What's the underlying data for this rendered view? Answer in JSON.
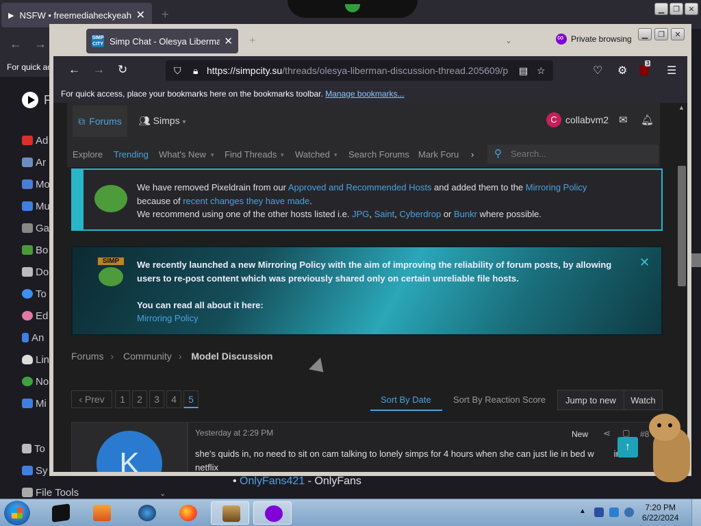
{
  "outer_browser": {
    "tab_title": "NSFW • freemediaheckyeah",
    "tab_close": "✕",
    "new_tab": "+",
    "bookmark_hint": "For quick ac",
    "sidebar_items": [
      {
        "label": "F",
        "icon": "play-logo"
      },
      {
        "label": "Ad",
        "icon": "stop-icon",
        "color": "#d9302c"
      },
      {
        "label": "Ar",
        "icon": "robot-icon",
        "color": "#6c8ebf"
      },
      {
        "label": "Mo",
        "icon": "tv-icon",
        "color": "#4a7fd0"
      },
      {
        "label": "Mu",
        "icon": "music-icon",
        "color": "#3f7fe0"
      },
      {
        "label": "Ga",
        "icon": "gamepad-icon",
        "color": "#888888"
      },
      {
        "label": "Bo",
        "icon": "book-icon",
        "color": "#4a9a3a"
      },
      {
        "label": "Do",
        "icon": "floppy-icon",
        "color": "#bbbbbb"
      },
      {
        "label": "To",
        "icon": "torrent-icon",
        "color": "#3f8ff0"
      },
      {
        "label": "Ed",
        "icon": "brain-icon",
        "color": "#e07aa0"
      },
      {
        "label": "An",
        "icon": "phone-icon",
        "color": "#3f7fe0"
      },
      {
        "label": "Lin",
        "icon": "penguin-icon",
        "color": "#dddddd"
      },
      {
        "label": "No",
        "icon": "globe-icon",
        "color": "#3fa040"
      },
      {
        "label": "Mi",
        "icon": "folder-icon",
        "color": "#3f7fe0"
      },
      {
        "label": "To",
        "icon": "wrench-icon",
        "color": "#bbbbbb"
      },
      {
        "label": "Sy",
        "icon": "computer-icon",
        "color": "#3f7fe0"
      },
      {
        "label": "File Tools",
        "icon": "file-icon",
        "color": "#aaaaaa"
      }
    ],
    "bottom_link": "OnlyFans421",
    "bottom_suffix": " - OnlyFans"
  },
  "front_browser": {
    "tab_title": "Simp Chat - Olesya Liberman - ",
    "tab_favicon": "SIMP CITY",
    "tab_close": "✕",
    "new_tab": "+",
    "private_label": "Private browsing",
    "url_host": "https://simpcity.su",
    "url_path": "/threads/olesya-liberman-discussion-thread.205609/p",
    "ublock_count": "3",
    "bookmarks_hint": "For quick access, place your bookmarks here on the bookmarks toolbar.",
    "bookmarks_link": "Manage bookmarks..."
  },
  "site": {
    "nav_forums": "Forums",
    "nav_simps": "Simps",
    "user_initial": "C",
    "username": "collabvm2",
    "subnav": [
      "Explore",
      "Trending",
      "What's New",
      "Find Threads",
      "Watched",
      "Search Forums",
      "Mark Foru"
    ],
    "search_placeholder": "Search...",
    "notice1": {
      "t1": "We have removed Pixeldrain from our ",
      "l1": "Approved and Recommended Hosts",
      "t2": " and added them to the ",
      "l2": "Mirroring Policy",
      "t3": "because of ",
      "l3": "recent changes they have made",
      "t4": ".",
      "t5": "We recommend using one of the other hosts listed i.e. ",
      "l4": "JPG",
      "c1": ", ",
      "l5": "Saint",
      "c2": ", ",
      "l6": "Cyberdrop",
      "t6": " or ",
      "l7": "Bunkr",
      "t7": " where possible."
    },
    "notice2": {
      "badge": "SIMP",
      "text": "We recently launched a new Mirroring Policy with the aim of improving the reliability of forum posts, by allowing users to re-post content which was previously shared only on certain unreliable file hosts.",
      "text2": "You can read all about it here:",
      "link": "Mirroring Policy",
      "close": "✕"
    },
    "breadcrumb": [
      "Forums",
      "Community",
      "Model Discussion"
    ],
    "pager": {
      "prev": "‹ Prev",
      "pages": [
        "1",
        "2",
        "3",
        "4",
        "5"
      ],
      "current": "5"
    },
    "sort_date": "Sort By Date",
    "sort_reaction": "Sort By Reaction Score",
    "jump_new": "Jump to new",
    "watch": "Watch",
    "post": {
      "avatar_initial": "K",
      "date": "Yesterday at 2:29 PM",
      "new_badge": "New",
      "number": "#8",
      "text": "she's quids in, no need to sit on cam talking to lonely simps for 4 hours when she can just lie in bed w",
      "text_after": "in",
      "text2": "netflix"
    }
  },
  "taskbar": {
    "time": "7:20 PM",
    "date": "6/22/2024",
    "apps": [
      "black-app-icon",
      "media-player-icon",
      "globe-app-icon",
      "firefox-icon",
      "box-app-icon",
      "private-browsing-icon"
    ]
  },
  "colors": {
    "accent": "#4aa3df",
    "notice_border": "#29b6c9",
    "avatar_c": "#c41f5a",
    "avatar_k": "#2a7bd0"
  }
}
